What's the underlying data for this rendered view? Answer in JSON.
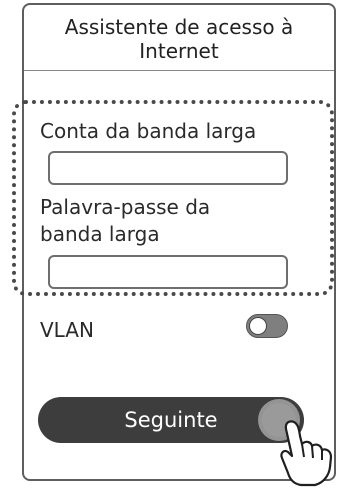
{
  "header": {
    "title": "Assistente de acesso à\nInternet"
  },
  "form": {
    "account_label": "Conta da banda larga",
    "account_value": "",
    "password_label": "Palavra-passe da\nbanda larga",
    "password_value": ""
  },
  "vlan": {
    "label": "VLAN",
    "enabled": false
  },
  "actions": {
    "next_label": "Seguinte"
  },
  "icons": {
    "toggle": "toggle-icon",
    "pointer": "hand-pointer-icon"
  },
  "colors": {
    "button": "#3d3d3d",
    "outline": "#5e5e5e",
    "text": "#2a2a2a"
  }
}
